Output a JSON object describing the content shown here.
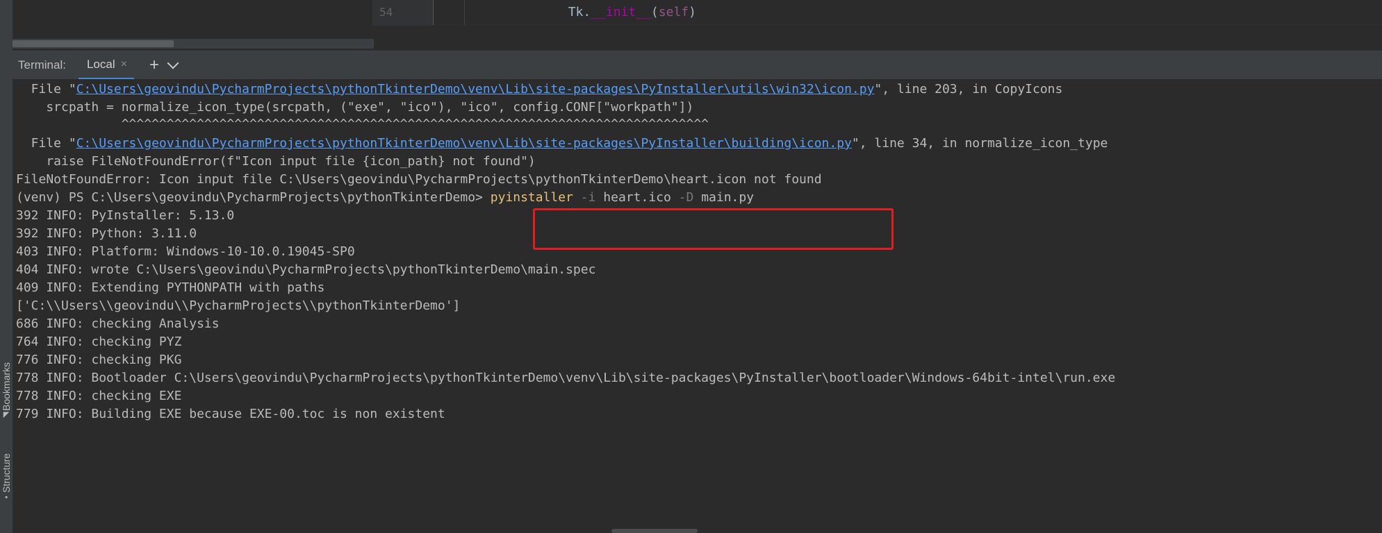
{
  "editor": {
    "line_number": "54",
    "code": {
      "prefix": "        Tk.",
      "dunder": "__init__",
      "open": "(",
      "self": "self",
      "close": ")"
    }
  },
  "terminal": {
    "title": "Terminal:",
    "tab_label": "Local",
    "tab_close_glyph": "×",
    "add_glyph": "+",
    "lines": {
      "l0": {
        "pre": "  File \"",
        "link": "C:\\Users\\geovindu\\PycharmProjects\\pythonTkinterDemo\\venv\\Lib\\site-packages\\PyInstaller\\utils\\win32\\icon.py",
        "post": "\", line 203, in CopyIcons"
      },
      "l1": "    srcpath = normalize_icon_type(srcpath, (\"exe\", \"ico\"), \"ico\", config.CONF[\"workpath\"])",
      "l2": "              ^^^^^^^^^^^^^^^^^^^^^^^^^^^^^^^^^^^^^^^^^^^^^^^^^^^^^^^^^^^^^^^^^^^^^^^^^^^^^^",
      "l3": {
        "pre": "  File \"",
        "link": "C:\\Users\\geovindu\\PycharmProjects\\pythonTkinterDemo\\venv\\Lib\\site-packages\\PyInstaller\\building\\icon.py",
        "post": "\", line 34, in normalize_icon_type"
      },
      "l4": "    raise FileNotFoundError(f\"Icon input file {icon_path} not found\")",
      "l5": "FileNotFoundError: Icon input file C:\\Users\\geovindu\\PycharmProjects\\pythonTkinterDemo\\heart.icon not found",
      "l6": {
        "prompt": "(venv) PS C:\\Users\\geovindu\\PycharmProjects\\pythonTkinterDemo> ",
        "cmd": "pyinstaller",
        "flag1": " -i",
        "arg1": " heart.ico",
        "flag2": " -D",
        "arg2": " main.py"
      },
      "l7": "392 INFO: PyInstaller: 5.13.0",
      "l8": "392 INFO: Python: 3.11.0",
      "l9": "403 INFO: Platform: Windows-10-10.0.19045-SP0",
      "l10": "404 INFO: wrote C:\\Users\\geovindu\\PycharmProjects\\pythonTkinterDemo\\main.spec",
      "l11": "409 INFO: Extending PYTHONPATH with paths",
      "l12": "['C:\\\\Users\\\\geovindu\\\\PycharmProjects\\\\pythonTkinterDemo']",
      "l13": "686 INFO: checking Analysis",
      "l14": "764 INFO: checking PYZ",
      "l15": "776 INFO: checking PKG",
      "l16": "778 INFO: Bootloader C:\\Users\\geovindu\\PycharmProjects\\pythonTkinterDemo\\venv\\Lib\\site-packages\\PyInstaller\\bootloader\\Windows-64bit-intel\\run.exe",
      "l17": "778 INFO: checking EXE",
      "l18": "779 INFO: Building EXE because EXE-00.toc is non existent"
    }
  },
  "sidebar": {
    "structure_label": "Structure",
    "bookmarks_label": "Bookmarks"
  },
  "colors": {
    "background": "#2b2b2b",
    "panel": "#3c3f41",
    "link": "#589df6",
    "command": "#e5c07b",
    "highlight": "#e02020"
  }
}
